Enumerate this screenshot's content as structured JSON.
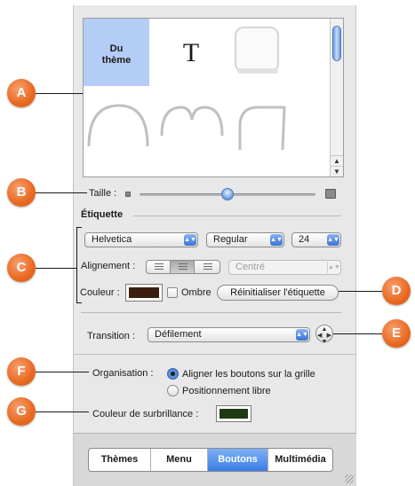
{
  "callouts": [
    "A",
    "B",
    "C",
    "D",
    "E",
    "F",
    "G"
  ],
  "thumbnails": {
    "theme_label_line1": "Du",
    "theme_label_line2": "thème",
    "text_glyph": "T"
  },
  "size": {
    "label": "Taille :",
    "value_fraction": 0.5
  },
  "etiquette": {
    "heading": "Étiquette",
    "font": "Helvetica",
    "style": "Regular",
    "size": "24",
    "alignment_label": "Alignement :",
    "alignment_popup": "Centré",
    "color_label": "Couleur :",
    "color": "#3a1f10",
    "shadow_label": "Ombre",
    "reset_button": "Réinitialiser l'étiquette"
  },
  "transition": {
    "label": "Transition :",
    "value": "Défilement"
  },
  "organisation": {
    "label": "Organisation :",
    "options": [
      "Aligner les boutons sur la grille",
      "Positionnement libre"
    ],
    "selected_index": 0
  },
  "highlight": {
    "label": "Couleur de surbrillance :",
    "color": "#1e3a14"
  },
  "tabs": [
    {
      "label": "Thèmes",
      "active": false
    },
    {
      "label": "Menu",
      "active": false
    },
    {
      "label": "Boutons",
      "active": true
    },
    {
      "label": "Multimédia",
      "active": false
    }
  ],
  "colors": {
    "accent": "#3a7ee6",
    "callout": "#e8691f",
    "selection": "#b4cdf6"
  }
}
